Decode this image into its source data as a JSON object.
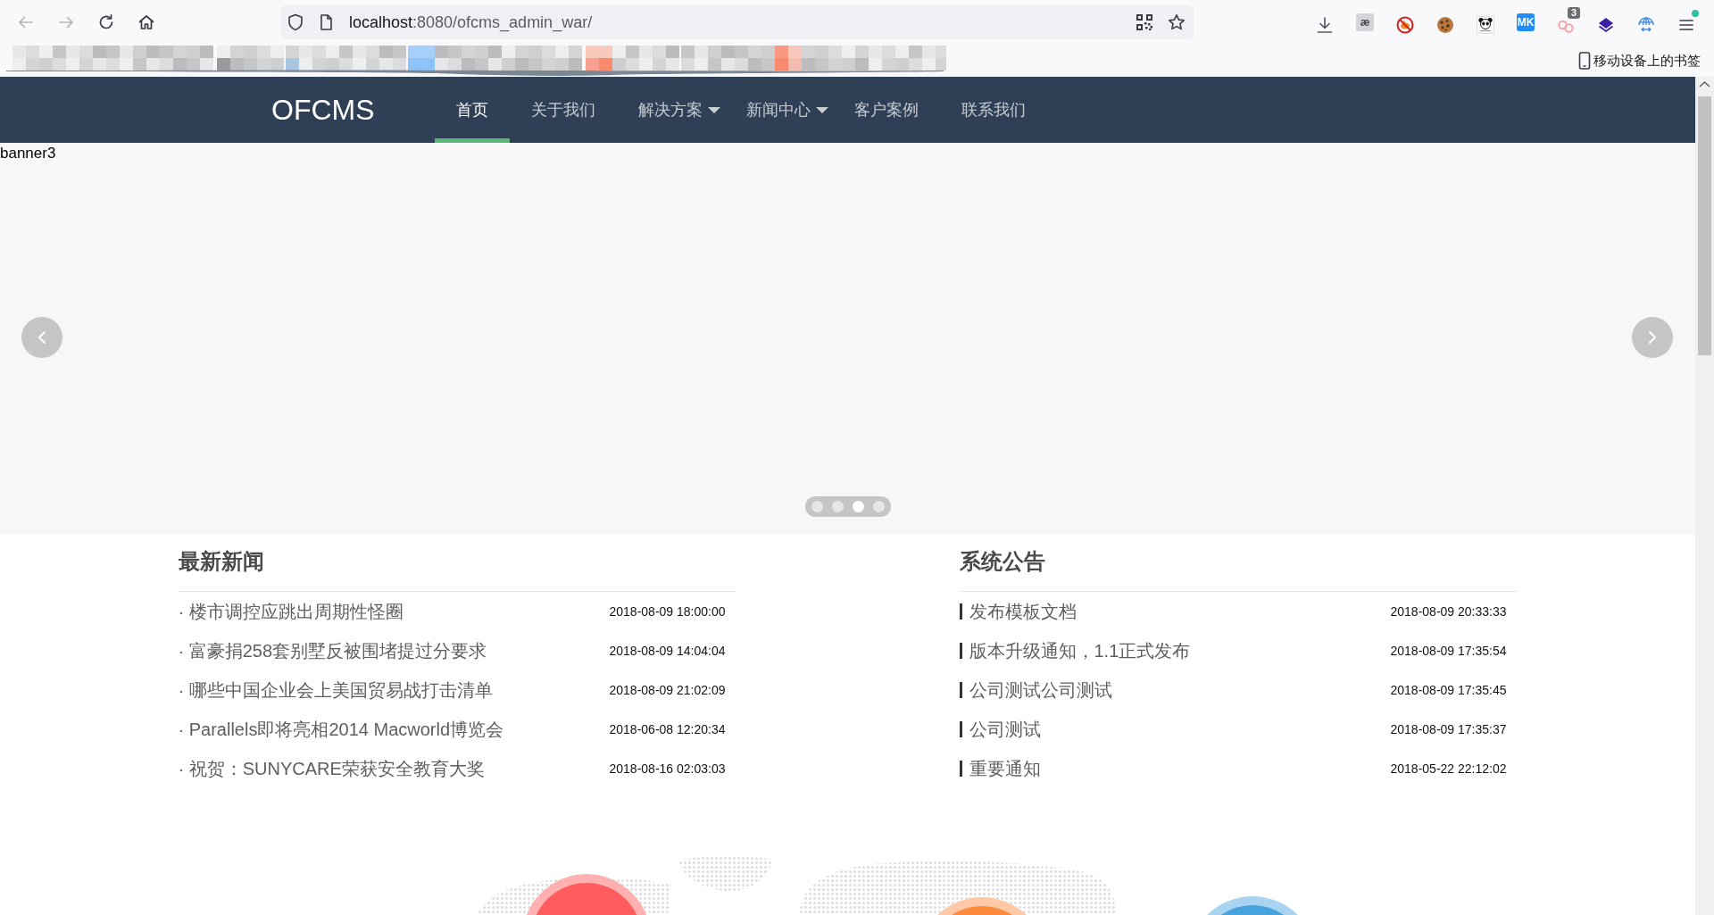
{
  "browser": {
    "nav_buttons": [
      {
        "kind": "back",
        "disabled": true
      },
      {
        "kind": "forward",
        "disabled": true
      },
      {
        "kind": "reload",
        "disabled": false
      },
      {
        "kind": "home",
        "disabled": false
      }
    ],
    "address": {
      "host": "localhost",
      "rest": ":8080/ofcms_admin_war/"
    },
    "extensions": [
      {
        "kind": "download"
      },
      {
        "kind": "tile",
        "label": "æ",
        "color": "#d4d4d8"
      },
      {
        "kind": "blocked"
      },
      {
        "kind": "cookie"
      },
      {
        "kind": "panda"
      },
      {
        "kind": "tile",
        "label": "MK",
        "color": "#1e8efa"
      },
      {
        "kind": "circles",
        "badge": "3"
      },
      {
        "kind": "layers"
      },
      {
        "kind": "globe"
      }
    ],
    "bookmarks_folder": "移动设备上的书签"
  },
  "navbar": {
    "brand": "OFCMS",
    "items": [
      {
        "label": "首页",
        "selected": true,
        "has_dropdown": false
      },
      {
        "label": "关于我们",
        "selected": false,
        "has_dropdown": false
      },
      {
        "label": "解决方案",
        "selected": false,
        "has_dropdown": true
      },
      {
        "label": "新闻中心",
        "selected": false,
        "has_dropdown": true
      },
      {
        "label": "客户案例",
        "selected": false,
        "has_dropdown": false
      },
      {
        "label": "联系我们",
        "selected": false,
        "has_dropdown": false
      }
    ]
  },
  "banner": {
    "image_alt": "banner3",
    "indicators": [
      {
        "selected": false
      },
      {
        "selected": false
      },
      {
        "selected": true
      },
      {
        "selected": false
      }
    ]
  },
  "sections": [
    {
      "kind": "news",
      "title": "最新新闻",
      "items": [
        {
          "title": "· 楼市调控应跳出周期性怪圈",
          "date": "2018-08-09 18:00:00"
        },
        {
          "title": "· 富豪捐258套别墅反被围堵提过分要求",
          "date": "2018-08-09 14:04:04"
        },
        {
          "title": "· 哪些中国企业会上美国贸易战打击清单",
          "date": "2018-08-09 21:02:09"
        },
        {
          "title": "· Parallels即将亮相2014 Macworld博览会",
          "date": "2018-06-08 12:20:34"
        },
        {
          "title": "· 祝贺：SUNYCARE荣获安全教育大奖",
          "date": "2018-08-16 02:03:03"
        }
      ]
    },
    {
      "kind": "notice",
      "title": "系统公告",
      "items": [
        {
          "title": "发布模板文档",
          "date": "2018-08-09 20:33:33"
        },
        {
          "title": "版本升级通知，1.1正式发布",
          "date": "2018-08-09 17:35:54"
        },
        {
          "title": "公司测试公司测试",
          "date": "2018-08-09 17:35:45"
        },
        {
          "title": "公司测试",
          "date": "2018-08-09 17:35:37"
        },
        {
          "title": "重要通知",
          "date": "2018-05-22 22:12:02"
        }
      ]
    }
  ]
}
